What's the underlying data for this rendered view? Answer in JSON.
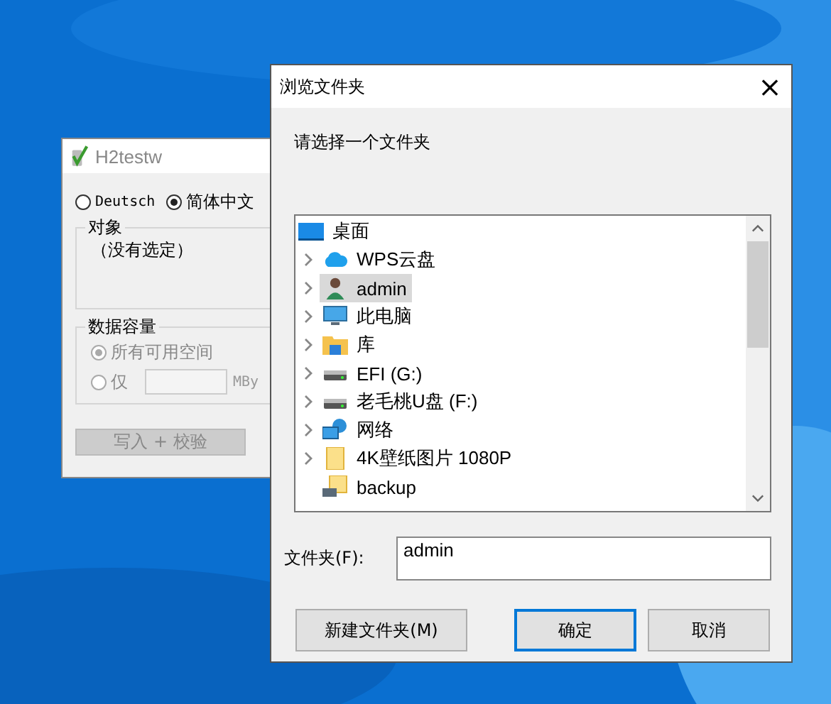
{
  "back_window": {
    "title": "H2testw",
    "languages": [
      {
        "label": "Deutsch",
        "selected": false
      },
      {
        "label": "简体中文",
        "selected": true
      }
    ],
    "target_group": {
      "title": "对象",
      "value": "（没有选定）"
    },
    "capacity_group": {
      "title": "数据容量",
      "disabled": true,
      "options": [
        {
          "label": "所有可用空间",
          "selected": true
        },
        {
          "label": "仅",
          "selected": false
        }
      ],
      "unit": "MBy"
    },
    "write_button": {
      "label": "写入 + 校验",
      "disabled": true
    }
  },
  "dialog": {
    "title": "浏览文件夹",
    "close": "×",
    "prompt": "请选择一个文件夹",
    "tree": [
      {
        "label": "桌面",
        "kind": "desktop",
        "expandable": false,
        "selected": false,
        "children": [
          {
            "label": "WPS云盘",
            "kind": "cloud",
            "expandable": true,
            "selected": false
          },
          {
            "label": "admin",
            "kind": "user",
            "expandable": true,
            "selected": true
          },
          {
            "label": "此电脑",
            "kind": "computer",
            "expandable": true,
            "selected": false
          },
          {
            "label": "库",
            "kind": "library",
            "expandable": true,
            "selected": false
          },
          {
            "label": "EFI (G:)",
            "kind": "drive",
            "expandable": true,
            "selected": false
          },
          {
            "label": "老毛桃U盘 (F:)",
            "kind": "drive",
            "expandable": true,
            "selected": false
          },
          {
            "label": "网络",
            "kind": "network",
            "expandable": true,
            "selected": false
          },
          {
            "label": "4K壁纸图片 1080P",
            "kind": "folder",
            "expandable": true,
            "selected": false
          },
          {
            "label": "backup",
            "kind": "shared",
            "expandable": false,
            "selected": false
          }
        ]
      }
    ],
    "folder_label": "文件夹(F):",
    "folder_value": "admin",
    "buttons": [
      {
        "label": "新建文件夹(M)",
        "default": false
      },
      {
        "label": "确定",
        "default": true
      },
      {
        "label": "取消",
        "default": false
      }
    ]
  }
}
